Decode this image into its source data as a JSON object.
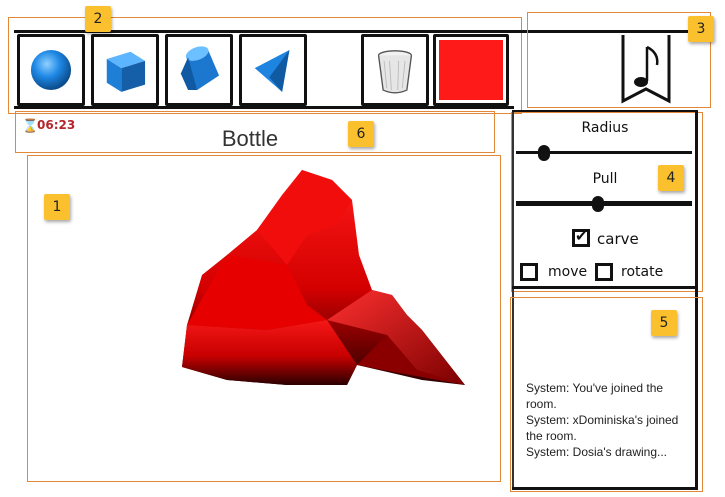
{
  "annotations": {
    "viewport_badge": "1",
    "toolbar_badge": "2",
    "sound_badge": "3",
    "controls_badge": "4",
    "chat_badge": "5",
    "title_badge": "6"
  },
  "toolbar": {
    "tools": [
      "sphere-icon",
      "cube-icon",
      "cylinder-icon",
      "cone-icon",
      "cup-icon"
    ],
    "color_swatch": "#ff1a1a"
  },
  "timer": {
    "value": "06:23",
    "icon": "hourglass-icon",
    "color": "#b3262b"
  },
  "title": {
    "text": "Bottle"
  },
  "controls": {
    "radius_label": "Radius",
    "radius_value": 0.12,
    "pull_label": "Pull",
    "pull_value": 0.55,
    "carve_label": "carve",
    "carve_checked": true,
    "move_label": "move",
    "move_checked": false,
    "rotate_label": "rotate",
    "rotate_checked": false
  },
  "sound": {
    "icon": "music-note-icon"
  },
  "chat": {
    "messages": [
      "System: You've joined the room.",
      "System: xDominiska's joined the room.",
      "System: Dosia's drawing..."
    ]
  },
  "model": {
    "color": "#e00000",
    "shade": "#2a0000"
  }
}
